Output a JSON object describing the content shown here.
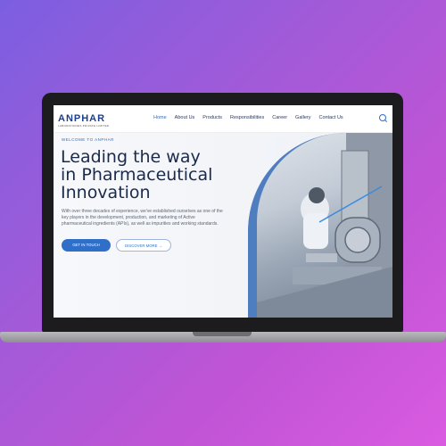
{
  "nav": {
    "logo": "ANPHAR",
    "logo_sub": "LABORATORIES PRIVATE LIMITED",
    "items": [
      "Home",
      "About Us",
      "Products",
      "Responsibilities",
      "Career",
      "Gallery",
      "Contact Us"
    ]
  },
  "hero": {
    "eyebrow": "WELCOME TO ANPHAR",
    "headline": [
      "Leading the way",
      "in Pharmaceutical",
      "Innovation"
    ],
    "description": "With over three decades of experience, we've established ourselves as one of the key players in the development, production, and marketing of Active pharmaceutical ingredients (APIs), as well as impurities and working standards.",
    "primary_button": "GET IN TOUCH",
    "secondary_button": "DISCOVER MORE →"
  },
  "colors": {
    "accent": "#2f6fc7",
    "brand": "#1a3f8f",
    "background_gradient": [
      "#7b5fe0",
      "#d95be0"
    ]
  }
}
